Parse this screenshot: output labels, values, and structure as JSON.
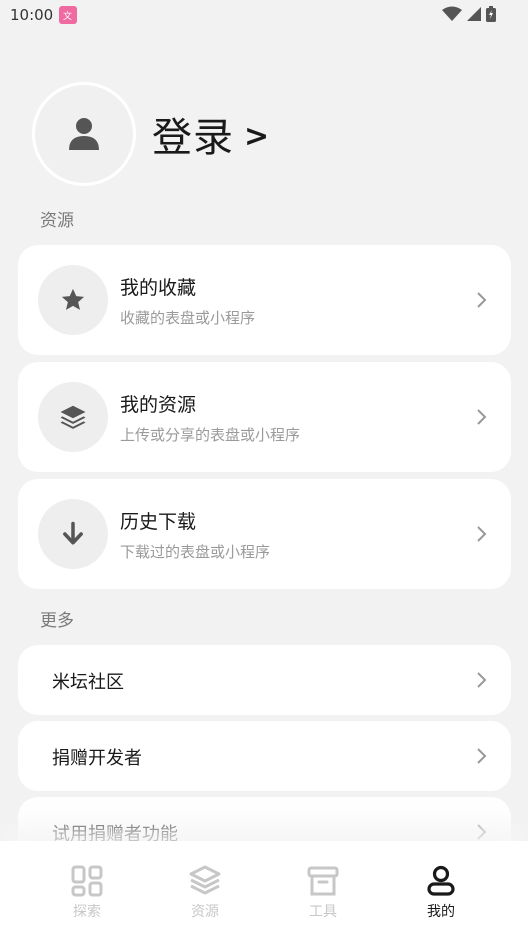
{
  "status_bar": {
    "time": "10:00"
  },
  "profile": {
    "login_label": "登录",
    "login_arrow": ">"
  },
  "sections": {
    "resources_title": "资源",
    "more_title": "更多"
  },
  "resource_items": [
    {
      "title": "我的收藏",
      "subtitle": "收藏的表盘或小程序",
      "icon": "star-icon"
    },
    {
      "title": "我的资源",
      "subtitle": "上传或分享的表盘或小程序",
      "icon": "layers-icon"
    },
    {
      "title": "历史下载",
      "subtitle": "下载过的表盘或小程序",
      "icon": "download-arrow-icon"
    }
  ],
  "more_items": [
    {
      "title": "米坛社区"
    },
    {
      "title": "捐赠开发者"
    },
    {
      "title": "试用捐赠者功能"
    }
  ],
  "tabs": [
    {
      "label": "探索",
      "icon": "grid-icon",
      "active": false
    },
    {
      "label": "资源",
      "icon": "layers-icon",
      "active": false
    },
    {
      "label": "工具",
      "icon": "toolbox-icon",
      "active": false
    },
    {
      "label": "我的",
      "icon": "person-icon",
      "active": true
    }
  ],
  "colors": {
    "background": "#f2f2f2",
    "card": "#ffffff",
    "icon_circle": "#eeeeee",
    "text_primary": "#1a1a1a",
    "text_secondary": "#9a9a9a",
    "tab_inactive": "#c7c7c7"
  }
}
